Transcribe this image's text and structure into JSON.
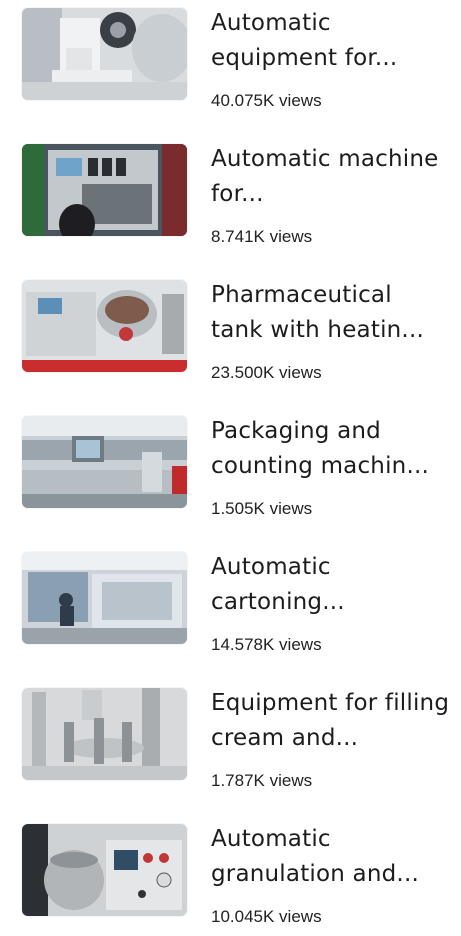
{
  "videos": [
    {
      "title": "Automatic equipment for...",
      "views": "40.075K views"
    },
    {
      "title": "Automatic machine for...",
      "views": "8.741K views"
    },
    {
      "title": "Pharmaceutical tank with heatin...",
      "views": "23.500K views"
    },
    {
      "title": "Packaging and counting machin...",
      "views": "1.505K views"
    },
    {
      "title": "Automatic cartoning...",
      "views": "14.578K views"
    },
    {
      "title": "Equipment for filling cream and...",
      "views": "1.787K views"
    },
    {
      "title": "Automatic granulation and...",
      "views": "10.045K views"
    }
  ]
}
